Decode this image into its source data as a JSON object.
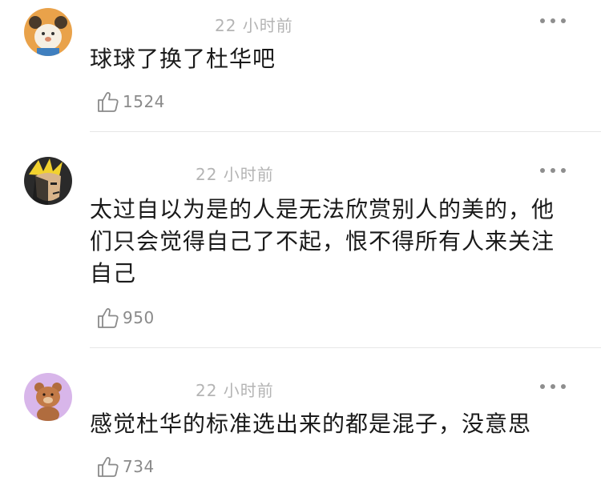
{
  "comments": [
    {
      "time": "22 小时前",
      "text": "球球了换了杜华吧",
      "likes": "1524",
      "avatar_icon": "cartoon-bear-avatar-icon"
    },
    {
      "time": "22 小时前",
      "text": "太过自以为是的人是无法欣赏别人的美的，他们只会觉得自己了不起，恨不得所有人来关注自己",
      "likes": "950",
      "avatar_icon": "anime-character-avatar-icon"
    },
    {
      "time": "22 小时前",
      "text": "感觉杜华的标准选出来的都是混子，没意思",
      "likes": "734",
      "avatar_icon": "teddy-bear-avatar-icon"
    }
  ],
  "colors": {
    "time": "#b4b4b4",
    "text": "#1a1a1a",
    "like": "#8a8a8a",
    "divider": "#e6e6e6"
  }
}
